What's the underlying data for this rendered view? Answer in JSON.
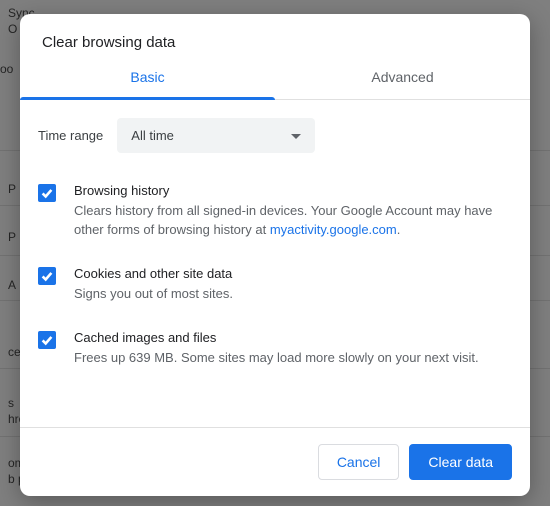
{
  "background": {
    "items": [
      "Sync",
      "O",
      "oo",
      "P",
      "P",
      "A",
      "ce",
      "s",
      "hro",
      "ome",
      "b p"
    ]
  },
  "dialog": {
    "title": "Clear browsing data",
    "tabs": {
      "basic": "Basic",
      "advanced": "Advanced"
    },
    "time_range_label": "Time range",
    "time_range_value": "All time",
    "options": {
      "history": {
        "title": "Browsing history",
        "desc_prefix": "Clears history from all signed-in devices. Your Google Account may have other forms of browsing history at ",
        "link_text": "myactivity.google.com",
        "desc_suffix": "."
      },
      "cookies": {
        "title": "Cookies and other site data",
        "desc": "Signs you out of most sites."
      },
      "cache": {
        "title": "Cached images and files",
        "desc": "Frees up 639 MB. Some sites may load more slowly on your next visit."
      }
    },
    "buttons": {
      "cancel": "Cancel",
      "confirm": "Clear data"
    }
  }
}
